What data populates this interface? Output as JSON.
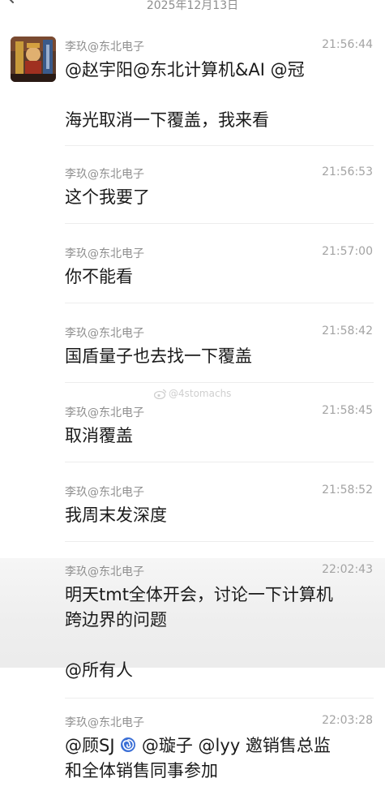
{
  "header": {
    "date": "2025年12月13日"
  },
  "watermark": {
    "text": "@4stomachs"
  },
  "messages": [
    {
      "sender": "李玖@东北电子",
      "time": "21:56:44",
      "text": "@赵宇阳@东北计算机&AI @冠\n\n海光取消一下覆盖，我来看"
    },
    {
      "sender": "李玖@东北电子",
      "time": "21:56:53",
      "text": "这个我要了"
    },
    {
      "sender": "李玖@东北电子",
      "time": "21:57:00",
      "text": "你不能看"
    },
    {
      "sender": "李玖@东北电子",
      "time": "21:58:42",
      "text": "国盾量子也去找一下覆盖"
    },
    {
      "sender": "李玖@东北电子",
      "time": "21:58:45",
      "text": "取消覆盖"
    },
    {
      "sender": "李玖@东北电子",
      "time": "21:58:52",
      "text": "我周末发深度"
    },
    {
      "sender": "李玖@东北电子",
      "time": "22:02:43",
      "text": "明天tmt全体开会，讨论一下计算机\n跨边界的问题\n\n@所有人"
    },
    {
      "sender": "李玖@东北电子",
      "time": "22:03:28",
      "text_part1": "@顾SJ ",
      "text_part2": " @璇子 @lyy 邀销售总监\n和全体销售同事参加"
    }
  ],
  "colors": {
    "sender": "#8f8f8f",
    "time": "#a3a3a3",
    "body": "#1a1a1a",
    "divider": "#ededed",
    "gray_band": "#eeeeee"
  },
  "icons": {
    "back": "chevron-left-icon",
    "swirl": "cyclone-emoji-icon",
    "weibo": "weibo-icon"
  }
}
